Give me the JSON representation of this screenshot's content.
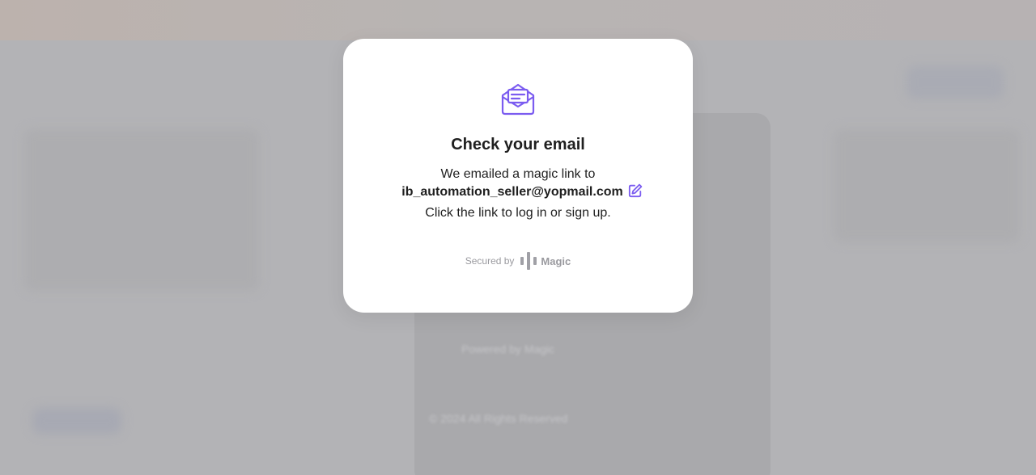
{
  "background": {
    "color": "#b3b3b6",
    "faint_items": [
      "Powered by Magic",
      "© 2024 All Rights Reserved"
    ]
  },
  "modal": {
    "icon": "mail-open-icon",
    "title": "Check your email",
    "line1": "We emailed a magic link to",
    "email": "ib_automation_seller@yopmail.com",
    "edit_icon": "edit-icon",
    "line3": "Click the link to log in or sign up.",
    "secured_label": "Secured by",
    "brand_name": "Magic",
    "brand_icon": "magic-logo-icon",
    "accent_color": "#7b5cf0"
  }
}
